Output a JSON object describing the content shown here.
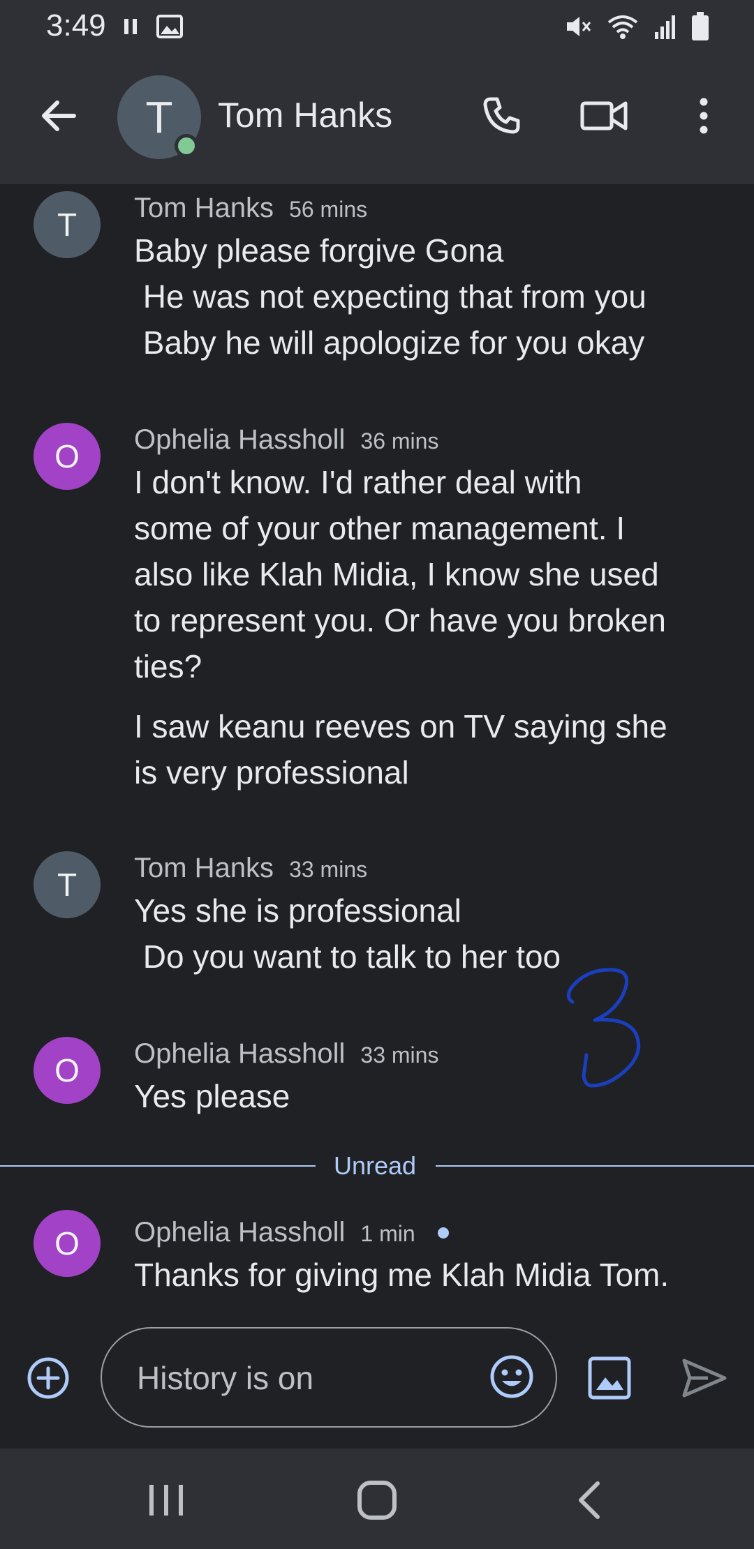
{
  "status_bar": {
    "time": "3:49"
  },
  "header": {
    "contact_name": "Tom Hanks",
    "avatar_initial": "T"
  },
  "messages": [
    {
      "initial": "T",
      "sender": "Tom Hanks",
      "time": "56 mins",
      "lines": [
        "Baby please forgive Gona",
        " He was not expecting that from you",
        " Baby he will apologize for you okay"
      ]
    },
    {
      "initial": "O",
      "sender": "Ophelia Hassholl",
      "time": "36 mins",
      "lines": [
        "I don't know. I'd rather deal with",
        "some of your other management. I",
        "also like Klah Midia, I know she used",
        "to represent you. Or have you broken",
        "ties?"
      ],
      "lines2": [
        "I saw keanu reeves on TV saying she",
        "is very professional"
      ]
    },
    {
      "initial": "T",
      "sender": "Tom Hanks",
      "time": "33 mins",
      "lines": [
        "Yes she is professional",
        " Do you want to talk to her too"
      ]
    },
    {
      "initial": "O",
      "sender": "Ophelia Hassholl",
      "time": "33 mins",
      "lines": [
        "Yes please"
      ]
    },
    {
      "initial": "O",
      "sender": "Ophelia Hassholl",
      "time": "1 min",
      "lines": [
        "Thanks for giving me Klah Midia Tom."
      ]
    }
  ],
  "unread_label": "Unread",
  "compose": {
    "placeholder": "History is on"
  },
  "colors": {
    "background": "#202124",
    "bar": "#2e3035",
    "accent": "#aecbfa",
    "avatar_t": "#4f5b66",
    "avatar_o": "#a142c7",
    "online": "#81c995",
    "annotation": "#1a3fbf"
  },
  "icons": [
    "pause-icon",
    "image-icon",
    "mute-icon",
    "wifi-icon",
    "signal-icon",
    "battery-icon",
    "back-arrow-icon",
    "phone-icon",
    "video-icon",
    "more-vert-icon",
    "add-circle-icon",
    "emoji-icon",
    "image-icon",
    "send-icon",
    "recents-icon",
    "home-icon",
    "nav-back-icon"
  ]
}
